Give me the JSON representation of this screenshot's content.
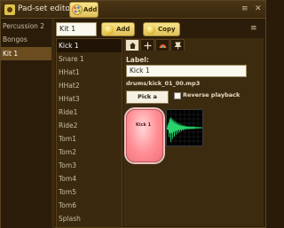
{
  "window": {
    "title": "Pad-set editors",
    "title_add_label": "Add",
    "controls": {
      "menu": "≡",
      "close": "✕"
    }
  },
  "kits": [
    {
      "label": "Percussion 2",
      "selected": false
    },
    {
      "label": "Bongos",
      "selected": false
    },
    {
      "label": "Kit 1",
      "selected": true
    }
  ],
  "kit_editor": {
    "name_value": "Kit 1",
    "add_label": "Add",
    "copy_label": "Copy",
    "menu": "≡"
  },
  "pads": [
    {
      "label": "Kick 1",
      "selected": true
    },
    {
      "label": "Snare 1",
      "selected": false
    },
    {
      "label": "HHat1",
      "selected": false
    },
    {
      "label": "HHat2",
      "selected": false
    },
    {
      "label": "HHat3",
      "selected": false
    },
    {
      "label": "Ride1",
      "selected": false
    },
    {
      "label": "Ride2",
      "selected": false
    },
    {
      "label": "Tom1",
      "selected": false
    },
    {
      "label": "Tom2",
      "selected": false
    },
    {
      "label": "Tom3",
      "selected": false
    },
    {
      "label": "Tom4",
      "selected": false
    },
    {
      "label": "Tom5",
      "selected": false
    },
    {
      "label": "Tom6",
      "selected": false
    },
    {
      "label": "Splash",
      "selected": false
    }
  ],
  "editor": {
    "tabs": [
      "home-icon",
      "crosshair-icon",
      "rainbow-icon",
      "pin-icon"
    ],
    "active_tab": 0,
    "label_caption": "Label:",
    "label_value": "Kick 1",
    "file_path": "drums/kick_01_00.mp3",
    "pick_sound_label": "Pick a sound",
    "reverse_playback_label": "Reverse playback",
    "reverse_playback_checked": false,
    "pad_preview_label": "Kick 1"
  },
  "colors": {
    "accent_yellow": "#f2d46e",
    "pad_pink": "#ff8d93",
    "selected_kit": "#6a4c1e",
    "waveform_green": "#27d36a"
  }
}
